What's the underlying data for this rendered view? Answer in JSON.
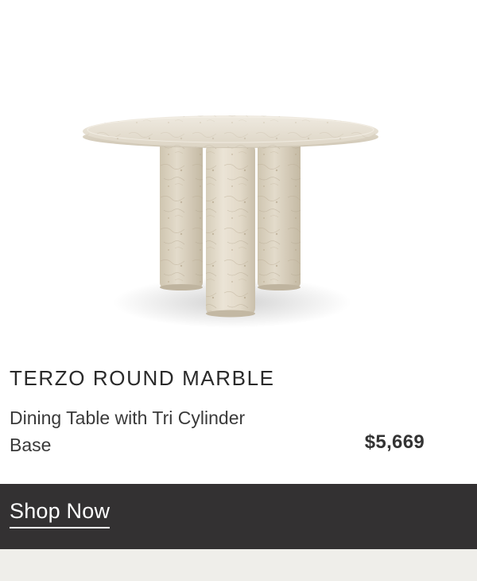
{
  "product": {
    "image_alt": "Terzo round marble dining table with three cylinder legs",
    "title": "TERZO ROUND MARBLE",
    "subtitle": "Dining Table with Tri Cylinder Base",
    "price": "$5,669"
  },
  "cta": {
    "label": "Shop Now"
  },
  "colors": {
    "cta_background": "#333132",
    "footer_background": "#efeeea",
    "marble": "#e6dfd0"
  }
}
